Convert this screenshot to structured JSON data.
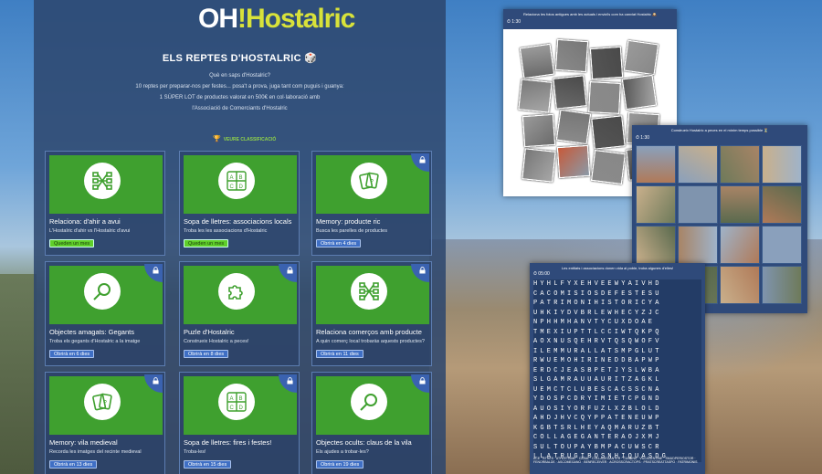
{
  "logo": {
    "oh": "OH",
    "hos": "!Hostalric"
  },
  "title": "ELS REPTES D'HOSTALRIC 🎲",
  "intro": [
    "Què en saps d'Hostalric?",
    "10 reptes per preparar-nos per festes... posa't a prova, juga tant com puguis i guanya:",
    "1 SÚPER LOT de productes valorat en 500€ en col·laboració amb",
    "l'Associació de Comerciants d'Hostalric"
  ],
  "classification_link": "VEURE CLASSIFICACIÓ",
  "cards": [
    {
      "title": "Relaciona: d'ahir a avui",
      "desc": "L'Hostalric d'ahir vs l'Hostalric d'avui",
      "badge": "Queden un mes",
      "status": "done",
      "icon": "network-icon",
      "locked": false
    },
    {
      "title": "Sopa de lletres: associacions locals",
      "desc": "Troba les les associacions d'Hostalric",
      "badge": "Queden un mes",
      "status": "done",
      "icon": "abcd-icon",
      "locked": false
    },
    {
      "title": "Memory: producte ric",
      "desc": "Busca les parelles de productes",
      "badge": "Obrirà en 4 dies",
      "status": "soon",
      "icon": "cards-icon",
      "locked": true
    },
    {
      "title": "Objectes amagats: Gegants",
      "desc": "Troba els gegants d'Hostalric a la imatge",
      "badge": "Obrirà en 6 dies",
      "status": "soon",
      "icon": "magnifier-icon",
      "locked": true
    },
    {
      "title": "Puzle d'Hostalric",
      "desc": "Construeix Hostalric a peces!",
      "badge": "Obrirà en 8 dies",
      "status": "soon",
      "icon": "puzzle-icon",
      "locked": true
    },
    {
      "title": "Relaciona comerços amb producte",
      "desc": "A quin comerç local trobaràs aquests productes?",
      "badge": "Obrirà en 11 dies",
      "status": "soon",
      "icon": "network-icon",
      "locked": true
    },
    {
      "title": "Memory: vila medieval",
      "desc": "Recorda les imatges del recinte medieval",
      "badge": "Obrirà en 13 dies",
      "status": "soon",
      "icon": "cards-icon",
      "locked": true
    },
    {
      "title": "Sopa de lletres: fires i festes!",
      "desc": "Troba-les!",
      "badge": "Obrirà en 15 dies",
      "status": "soon",
      "icon": "abcd-icon",
      "locked": true
    },
    {
      "title": "Objectes ocults: claus de la vila",
      "desc": "Els ajudes a trobar-les?",
      "badge": "Obrirà en 19 dies",
      "status": "soon",
      "icon": "magnifier-icon",
      "locked": true
    }
  ],
  "shot1": {
    "caption": "Relaciona les fotos antigues amb les actuals i envia'ls com ha canviat Hostalric 🕰️",
    "timer": "⏱ 1:30"
  },
  "shot2": {
    "caption": "Construeix Hostalric a peces en el mínim temps possible ⏳",
    "timer": "⏱ 1:30"
  },
  "shot3": {
    "caption": "Les entitats i associacions donen vida al poble, troba algunes d'elles!",
    "timer": "⏱ 05:00",
    "grid": [
      "HYHLFYXEHVEEWYAIVHD",
      "CACOMISIOSDEFESTESU",
      "PATRIMONIHISTORICYA",
      "UHKIYDVBRLEWHECYZJC",
      "NPHHMHANVTYCUXDOAE",
      "TMEXIUPTTLCCIWTQKPQ",
      "AOXNUSQEHRVTQSQWOFV",
      "ILEMMURALLATSMPGLUT",
      "RWUEMOHIRINEDDBAPWP",
      "ERDCJEASBPETJYSLWBA",
      "SLGAMRAUUAURITZAGKL",
      "UEMCTCLUBESCACSSCNA",
      "YDOSPCDRYIMIETCPGND",
      "AUOSIYORFUZLXZBLOLD",
      "AHDJHVCQYPPATENEUWP",
      "KGBTSRLHEYAQMARUZBT",
      "COLLAGEGANTERAOJXMJ",
      "SULTOUPAYBMPACUWSCR",
      "LLATRUGIBOSNHIQUASDG"
    ],
    "words": "ACE · BTHES · ATHLETISME · CASAL · COLLAGEGANTER · CUBRNS · VILLAGENTINE · SMUDPERIOSTOR · FENORBALDE · ASCOMEGANO · BENRECEIVER · ACROSSCRACTOPS · PRATSCREATTASPO · PATRIMONIS"
  }
}
